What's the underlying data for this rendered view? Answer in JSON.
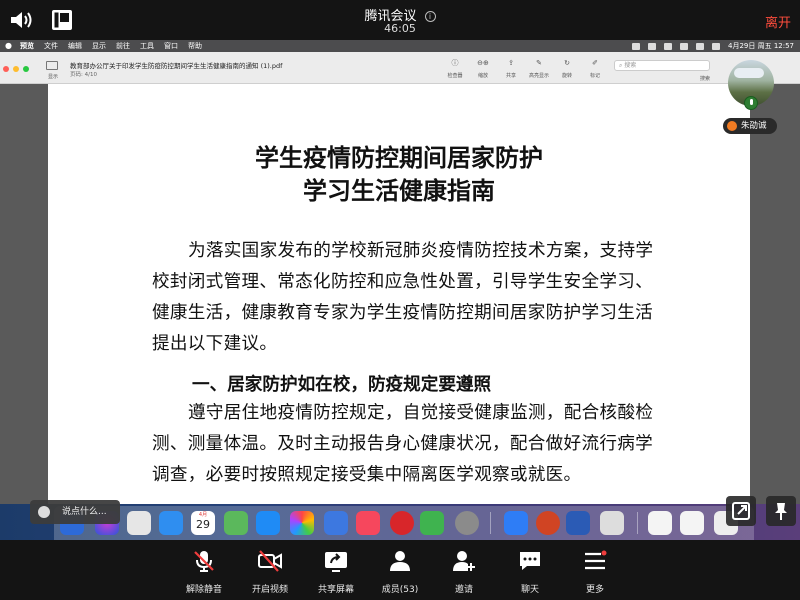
{
  "meeting": {
    "app_title": "腾讯会议",
    "elapsed": "46:05",
    "leave_label": "离开"
  },
  "mac_menubar": {
    "items": [
      "预览",
      "文件",
      "编辑",
      "显示",
      "前往",
      "工具",
      "窗口",
      "帮助"
    ],
    "clock": "4月29日 周五 12:57"
  },
  "preview": {
    "filename": "教育部办公厅关于印发学生防疫防控期间学生生活健康指南的通知 (1).pdf",
    "page_indicator": "页码: 4/10",
    "sidebar_label": "显示",
    "tools": [
      "检查器",
      "缩放",
      "共享",
      "高亮显示",
      "旋转",
      "标记"
    ],
    "search_placeholder": "搜索",
    "search_label": "搜索"
  },
  "document": {
    "title_line1": "学生疫情防控期间居家防护",
    "title_line2": "学习生活健康指南",
    "para1": [
      "为落实国家发布的学校新冠肺炎疫情防控技术方案，支持学",
      "校封闭式管理、常态化防控和应急性处置，引导学生安全学习、",
      "健康生活，健康教育专家为学生疫情防控期间居家防护学习生活",
      "提出以下建议。"
    ],
    "heading1": "一、居家防护如在校，防疫规定要遵照",
    "para2": [
      "遵守居住地疫情防控规定，自觉接受健康监测，配合核酸检",
      "测、测量体温。及时主动报告身心健康状况，配合做好流行病学",
      "调查，必要时按照规定接受集中隔离医学观察或就医。"
    ]
  },
  "participant": {
    "name": "朱劭诚"
  },
  "chat": {
    "placeholder": "说点什么..."
  },
  "dock": {
    "calendar_month": "4月",
    "calendar_day": "29"
  },
  "toolbar": {
    "buttons": [
      {
        "label": "解除静音",
        "icon": "mic-muted-icon"
      },
      {
        "label": "开启视频",
        "icon": "camera-off-icon"
      },
      {
        "label": "共享屏幕",
        "icon": "share-screen-icon"
      },
      {
        "label": "成员(53)",
        "icon": "members-icon"
      },
      {
        "label": "邀请",
        "icon": "invite-icon"
      },
      {
        "label": "聊天",
        "icon": "chat-icon"
      },
      {
        "label": "更多",
        "icon": "more-icon"
      }
    ]
  },
  "colors": {
    "leave": "#ff4d3d",
    "name_dot": "#f07b23"
  }
}
